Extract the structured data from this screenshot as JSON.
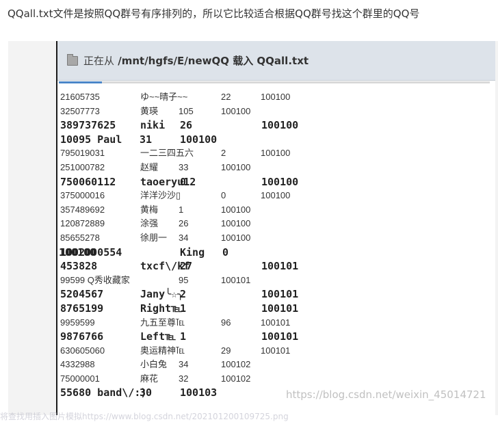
{
  "caption": "QQall.txt文件是按照QQ群号有序排列的，所以它比较适合根据QQ群号找这个群里的QQ号",
  "window": {
    "status_prefix": "正在从",
    "status_path": "/mnt/hgfs/E/newQQ 载入 QQall.txt",
    "progress_percent": 10
  },
  "rows": [
    {
      "style": "normal",
      "cols": [
        "21605735",
        "ゆ~~晴子~~",
        "22",
        "100100"
      ],
      "wide": true
    },
    {
      "style": "normal",
      "cols": [
        "32507773",
        "黄瑛",
        "105",
        "100100"
      ]
    },
    {
      "style": "bold",
      "cols": [
        "389737625",
        "niki",
        "26",
        "100100"
      ]
    },
    {
      "style": "bold",
      "cols": [
        "10095 Paul",
        "31",
        "100100"
      ],
      "shift": true
    },
    {
      "style": "normal",
      "cols": [
        "795019031",
        "一二三四五六",
        "2",
        "100100"
      ],
      "wide": true
    },
    {
      "style": "normal",
      "cols": [
        "251000782",
        "赵耀",
        "33",
        "100100"
      ]
    },
    {
      "style": "bold",
      "cols": [
        "750060112",
        "taoeryu12",
        "0",
        "100100"
      ]
    },
    {
      "style": "normal",
      "cols": [
        "375000016",
        "洋洋沙沙▯",
        "0",
        "100100"
      ],
      "wide": true
    },
    {
      "style": "normal",
      "cols": [
        "357489692",
        "黄梅",
        "1",
        "100100"
      ]
    },
    {
      "style": "normal",
      "cols": [
        "120872889",
        "涂强",
        "26",
        "100100"
      ]
    },
    {
      "style": "normal",
      "cols": [
        "85655278",
        "徐朋一",
        "34",
        "100100"
      ]
    },
    {
      "style": "bold",
      "cols": [
        "1002000554",
        "King",
        "0",
        "100100"
      ],
      "shift": true
    },
    {
      "style": "bold",
      "cols": [
        "453828",
        "txcf\\/kf",
        "27",
        "100101"
      ]
    },
    {
      "style": "normal",
      "cols": [
        "99599 Q秀收藏家",
        "95",
        "100101"
      ],
      "shift": true
    },
    {
      "style": "bold",
      "cols": [
        "5204567",
        "Jany╰☆╮",
        "2",
        "100101"
      ]
    },
    {
      "style": "bold",
      "cols": [
        "8765199",
        "Right℡",
        "1",
        "100101"
      ]
    },
    {
      "style": "normal",
      "cols": [
        "9959599",
        "九五至尊℡",
        "96",
        "100101"
      ],
      "wide": true
    },
    {
      "style": "bold",
      "cols": [
        "9876766",
        "Left℡",
        "1",
        "100101"
      ]
    },
    {
      "style": "normal",
      "cols": [
        "630605060",
        "奥运精神℡",
        "29",
        "100101"
      ],
      "wide": true
    },
    {
      "style": "normal",
      "cols": [
        "4332988",
        "小白兔",
        "34",
        "100102"
      ]
    },
    {
      "style": "normal",
      "cols": [
        "75000001",
        "麻花",
        "32",
        "100102"
      ]
    },
    {
      "style": "bold",
      "cols": [
        "55680 band\\/:)",
        "30",
        "100103"
      ],
      "shift": true
    }
  ],
  "watermark": "https://blog.csdn.net/weixin_45014721",
  "bottom_partial": "将查找用插入图片模拟https://www.blog.csdn.net/202101200109725.png"
}
